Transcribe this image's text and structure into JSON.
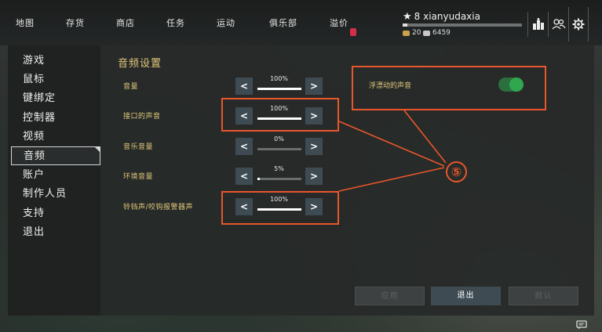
{
  "nav": [
    "地图",
    "存货",
    "商店",
    "任务",
    "运动",
    "俱乐部",
    "溢价"
  ],
  "profile": {
    "level_name": "8 xianyudaxia",
    "xp_progress": 0.04,
    "currency_gold": "20",
    "currency_silver": "6459"
  },
  "sidebar": [
    "游戏",
    "鼠标",
    "键绑定",
    "控制器",
    "视频",
    "音频",
    "账户",
    "制作人员",
    "支持",
    "退出"
  ],
  "active_sidebar": "音频",
  "section_title": "音频设置",
  "rows": [
    {
      "label": "音量",
      "value": "100%",
      "level": 1.0
    },
    {
      "label": "接口的声音",
      "value": "100%",
      "level": 1.0
    },
    {
      "label": "音乐音量",
      "value": "0%",
      "level": 0.0
    },
    {
      "label": "环境音量",
      "value": "5%",
      "level": 0.05
    },
    {
      "label": "铃铛声/咬钩报警器声",
      "value": "100%",
      "level": 1.0
    }
  ],
  "toggle": {
    "label": "浮漂动的声音",
    "on": true
  },
  "buttons": {
    "apply": "应用",
    "exit": "退出",
    "default": "默认"
  },
  "annotation": {
    "badge": "⑤",
    "color": "#e9562c"
  },
  "icons": [
    "star-icon",
    "gold-coin-icon",
    "silver-coin-icon",
    "leaderboard-icon",
    "friends-icon",
    "gear-icon",
    "chevron-left-icon",
    "chevron-right-icon",
    "chat-icon",
    "premium-tag-icon"
  ]
}
